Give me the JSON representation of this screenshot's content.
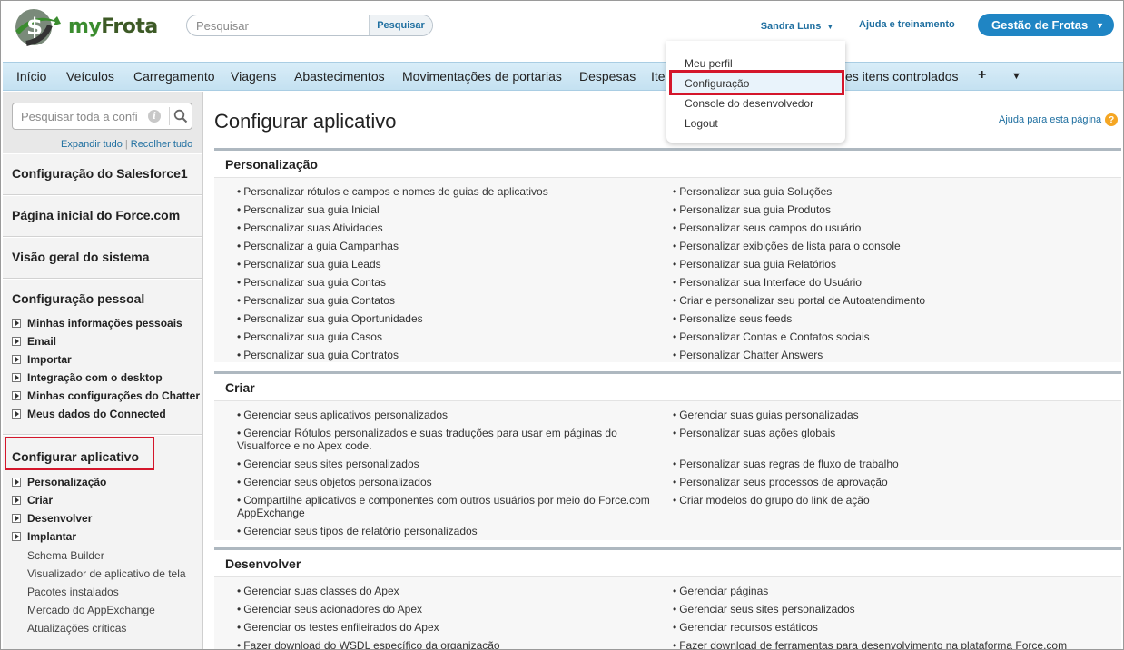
{
  "header": {
    "logo_text_my": "my",
    "logo_text_frota": "Frota",
    "search_placeholder": "Pesquisar",
    "search_button": "Pesquisar",
    "user_name": "Sandra Luns",
    "help_link": "Ajuda e treinamento",
    "app_name": "Gestão de Frotas"
  },
  "tabs": [
    "Início",
    "Veículos",
    "Carregamento",
    "Viagens",
    "Abastecimentos",
    "Movimentações de portarias",
    "Despesas",
    "Ite",
    "es itens controlados"
  ],
  "user_dropdown": {
    "items": [
      "Meu perfil",
      "Configuração",
      "Console do desenvolvedor",
      "Logout"
    ]
  },
  "sidebar": {
    "search_placeholder": "Pesquisar toda a confi",
    "expand_all": "Expandir tudo",
    "collapse_all": "Recolher tudo",
    "sections": [
      "Configuração do Salesforce1",
      "Página inicial do Force.com",
      "Visão geral do sistema"
    ],
    "personal": {
      "heading": "Configuração pessoal",
      "items": [
        "Minhas informações pessoais",
        "Email",
        "Importar",
        "Integração com o desktop",
        "Minhas configurações do Chatter",
        "Meus dados do Connected"
      ]
    },
    "app_setup": {
      "heading": "Configurar aplicativo",
      "items": [
        "Personalização",
        "Criar",
        "Desenvolver",
        "Implantar"
      ],
      "subitems": [
        "Schema Builder",
        "Visualizador de aplicativo de tela",
        "Pacotes instalados",
        "Mercado do AppExchange",
        "Atualizações críticas"
      ]
    }
  },
  "main": {
    "title": "Configurar aplicativo",
    "help_page": "Ajuda para esta página",
    "panels": [
      {
        "title": "Personalização",
        "left": [
          "Personalizar rótulos e campos e nomes de guias de aplicativos",
          "Personalizar sua guia Inicial",
          "Personalizar suas Atividades",
          "Personalizar a guia Campanhas",
          "Personalizar sua guia Leads",
          "Personalizar sua guia Contas",
          "Personalizar sua guia Contatos",
          "Personalizar sua guia Oportunidades",
          "Personalizar sua guia Casos",
          "Personalizar sua guia Contratos"
        ],
        "right": [
          "Personalizar sua guia Soluções",
          "Personalizar sua guia Produtos",
          "Personalizar seus campos do usuário",
          "Personalizar exibições de lista para o console",
          "Personalizar sua guia Relatórios",
          "Personalizar sua Interface do Usuário",
          "Criar e personalizar seu portal de Autoatendimento",
          "Personalize seus feeds",
          "Personalizar Contas e Contatos sociais",
          "Personalizar Chatter Answers"
        ]
      },
      {
        "title": "Criar",
        "left": [
          "Gerenciar seus aplicativos personalizados",
          "Gerenciar Rótulos personalizados e suas traduções para usar em páginas do",
          "Visualforce e no Apex code.",
          "Gerenciar seus sites personalizados",
          "Gerenciar seus objetos personalizados",
          "Compartilhe aplicativos e componentes com outros usuários por meio do Force.com",
          "AppExchange",
          "Gerenciar seus tipos de relatório personalizados"
        ],
        "right": [
          "Gerenciar suas guias personalizadas",
          "Personalizar suas ações globais",
          "Personalizar suas regras de fluxo de trabalho",
          "Personalizar seus processos de aprovação",
          "Criar modelos do grupo do link de ação"
        ]
      },
      {
        "title": "Desenvolver",
        "left": [
          "Gerenciar suas classes do Apex",
          "Gerenciar seus acionadores do Apex",
          "Gerenciar os testes enfileirados do Apex",
          "Fazer download do WSDL específico da organização"
        ],
        "right": [
          "Gerenciar páginas",
          "Gerenciar seus sites personalizados",
          "Gerenciar recursos estáticos",
          "Fazer download de ferramentas para desenvolvimento na plataforma Force.com"
        ]
      }
    ]
  },
  "colors": {
    "accent": "#1f85c4",
    "link": "#1f6fa0",
    "highlight_red": "#d4162b",
    "tabbar": "#c4e1f1"
  }
}
